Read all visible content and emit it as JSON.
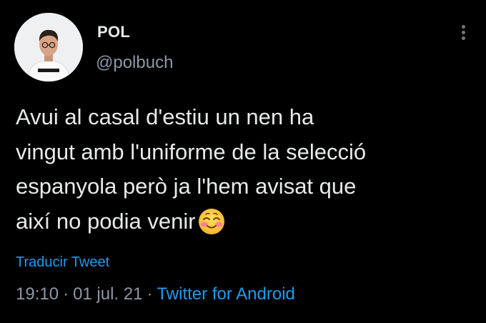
{
  "tweet": {
    "display_name": "POL",
    "handle": "@polbuch",
    "text": "Avui al casal d'estiu un nen ha\nvingut amb l'uniforme de la selecció\nespanyola però ja l'hem avisat que\naixí no podia venir",
    "emoji": "smiling-face-with-blush-icon",
    "translate_label": "Traducir Tweet",
    "time": "19:10",
    "date": "01 jul. 21",
    "separator": "·",
    "source": "Twitter for Android"
  },
  "colors": {
    "background": "#000000",
    "text": "#e7e9ea",
    "secondary": "#8b98a5",
    "link": "#1d9bf0"
  }
}
